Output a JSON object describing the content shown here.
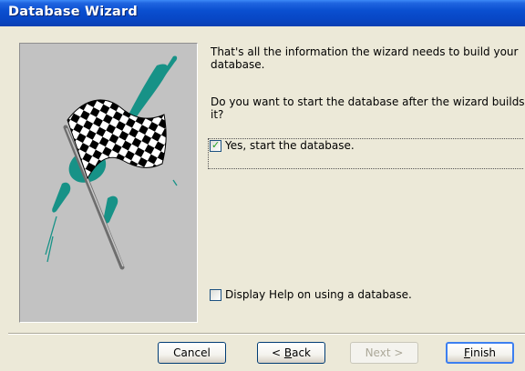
{
  "window": {
    "title": "Database Wizard"
  },
  "main": {
    "info_text": "That's all the information the wizard needs to build your database.",
    "question_text": "Do you want to start the database after the wizard builds it?",
    "start_checkbox": {
      "label": "Yes, start the database.",
      "checked": true,
      "mark": "✓"
    },
    "help_checkbox": {
      "label": "Display Help on using a database.",
      "checked": false
    }
  },
  "buttons": {
    "cancel": {
      "label": "Cancel"
    },
    "back": {
      "prefix": "< ",
      "mnemonic": "B",
      "rest": "ack"
    },
    "next": {
      "label": "Next >",
      "disabled": true
    },
    "finish": {
      "mnemonic": "F",
      "rest": "inish"
    }
  },
  "colors": {
    "titlebar": "#0a4fd0",
    "dialog_bg": "#ece9d8",
    "art_bg": "#c2c2c2",
    "art_teal": "#179287",
    "check_mark": "#21a121"
  },
  "icons": {
    "illustration": "checkered-flag-icon"
  }
}
